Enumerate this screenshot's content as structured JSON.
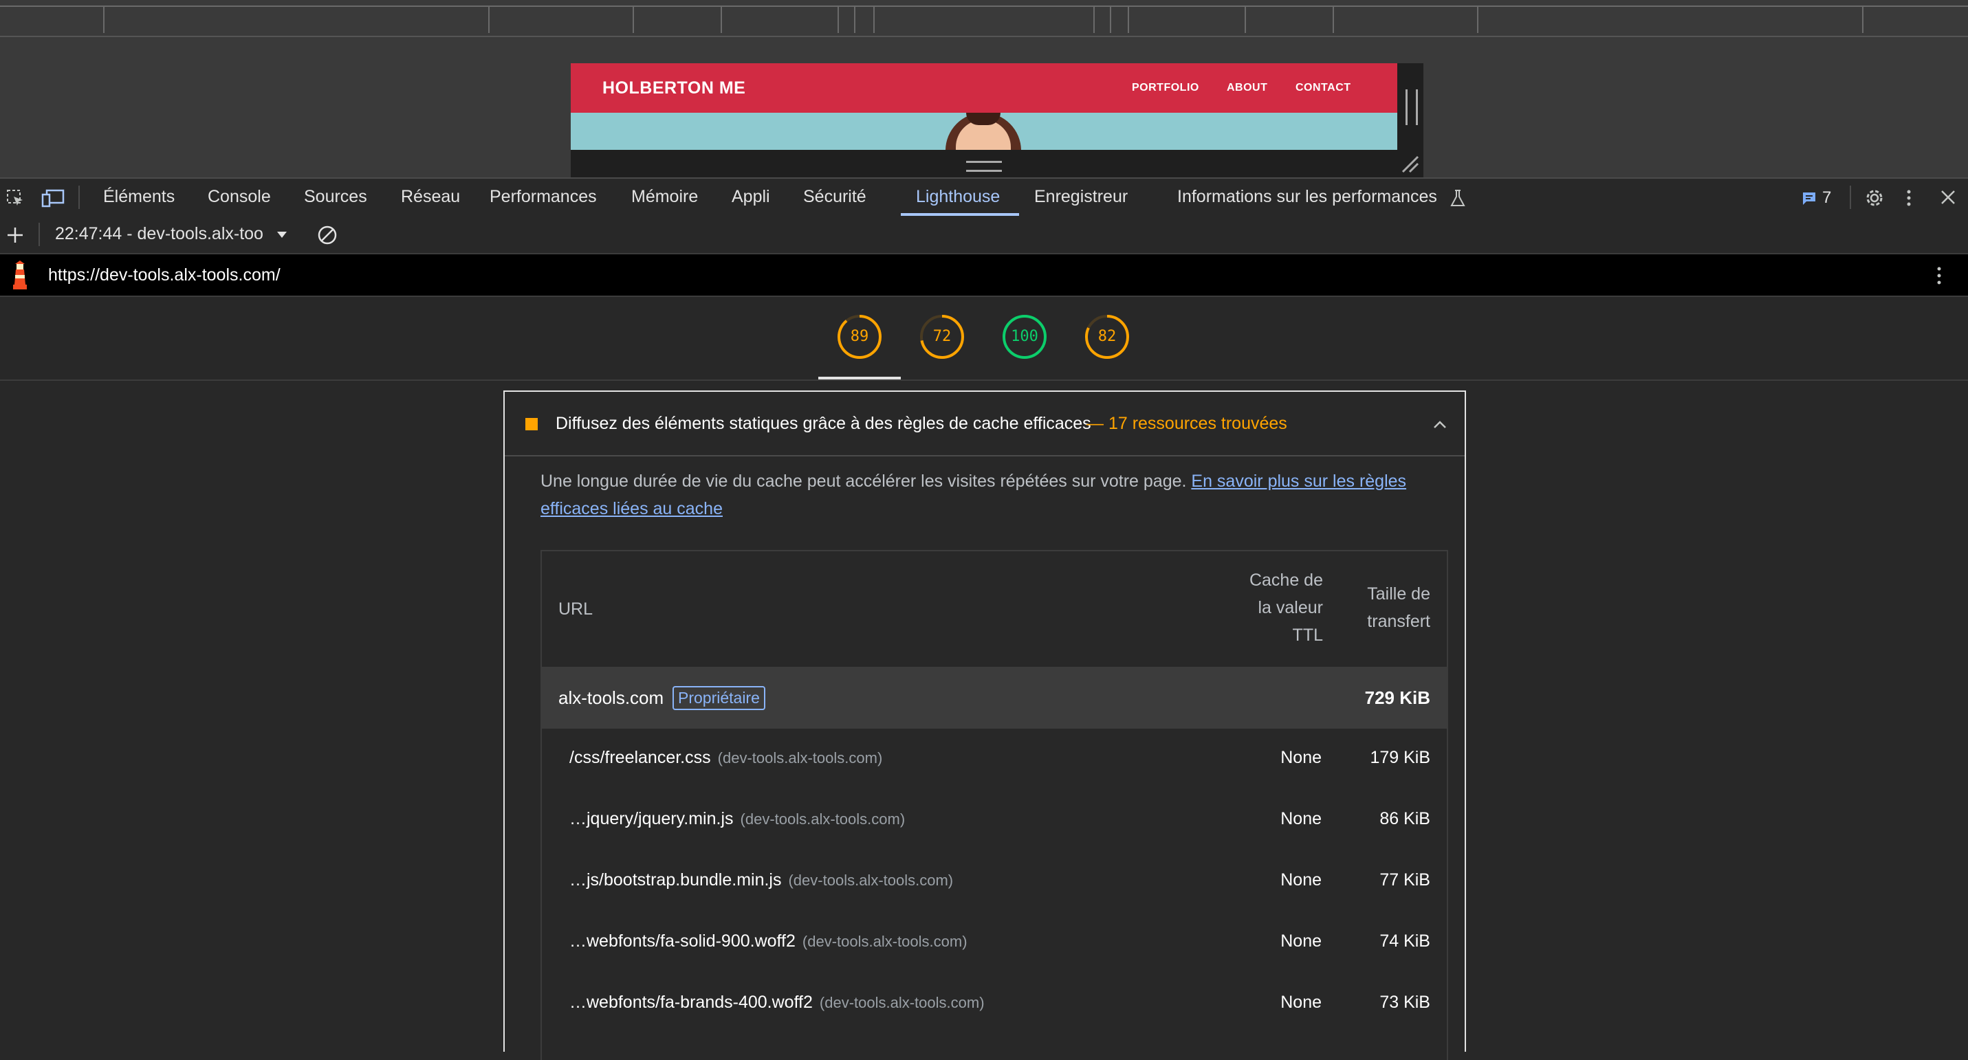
{
  "site_preview": {
    "brand": "HOLBERTON ME",
    "nav": [
      "PORTFOLIO",
      "ABOUT",
      "CONTACT"
    ]
  },
  "devtools": {
    "tabs": [
      "Éléments",
      "Console",
      "Sources",
      "Réseau",
      "Performances",
      "Mémoire",
      "Appli",
      "Sécurité",
      "Lighthouse",
      "Enregistreur",
      "Informations sur les performances"
    ],
    "active_tab": "Lighthouse",
    "issues_count": "7",
    "icons": [
      "inspect-icon",
      "device-toggle-icon",
      "flask-icon",
      "issues-icon",
      "gear-icon",
      "kebab-menu-icon",
      "close-icon"
    ]
  },
  "lighthouse": {
    "report_selector": "22:47:44 - dev-tools.alx-too",
    "url": "https://dev-tools.alx-tools.com/",
    "scores": [
      {
        "value": "89",
        "fraction": 0.89,
        "color": "#ffa400"
      },
      {
        "value": "72",
        "fraction": 0.72,
        "color": "#ffa400"
      },
      {
        "value": "100",
        "fraction": 1.0,
        "color": "#0cce6b"
      },
      {
        "value": "82",
        "fraction": 0.82,
        "color": "#ffa400"
      }
    ]
  },
  "audit": {
    "title": "Diffusez des éléments statiques grâce à des règles de cache efficaces",
    "display_value": "— 17 ressources trouvées",
    "description": "Une longue durée de vie du cache peut accélérer les visites répétées sur votre page.",
    "learn_more": "En savoir plus sur les règles efficaces liées au cache",
    "columns": {
      "url": "URL",
      "ttl_line1": "Cache de",
      "ttl_line2": "la valeur",
      "ttl_line3": "TTL",
      "size_line1": "Taille de",
      "size_line2": "transfert"
    },
    "group": {
      "host": "alx-tools.com",
      "badge": "Propriétaire",
      "size": "729 KiB"
    },
    "rows": [
      {
        "url": "/css/freelancer.css",
        "host": "(dev-tools.alx-tools.com)",
        "ttl": "None",
        "size": "179 KiB"
      },
      {
        "url": "…jquery/jquery.min.js",
        "host": "(dev-tools.alx-tools.com)",
        "ttl": "None",
        "size": "86 KiB"
      },
      {
        "url": "…js/bootstrap.bundle.min.js",
        "host": "(dev-tools.alx-tools.com)",
        "ttl": "None",
        "size": "77 KiB"
      },
      {
        "url": "…webfonts/fa-solid-900.woff2",
        "host": "(dev-tools.alx-tools.com)",
        "ttl": "None",
        "size": "74 KiB"
      },
      {
        "url": "…webfonts/fa-brands-400.woff2",
        "host": "(dev-tools.alx-tools.com)",
        "ttl": "None",
        "size": "73 KiB"
      }
    ]
  }
}
